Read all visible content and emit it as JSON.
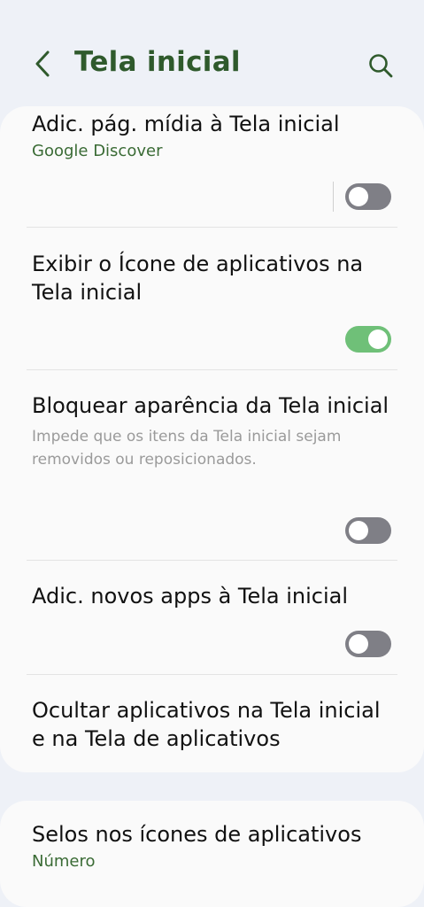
{
  "header": {
    "title": "Tela inicial",
    "back_icon": "back-arrow-icon",
    "search_icon": "search-icon"
  },
  "settings": [
    {
      "title": "Adic. pág. mídia à Tela inicial",
      "subtitle": "Google Discover",
      "toggle": "off"
    },
    {
      "title": "Exibir o Ícone de aplicativos na Tela inicial",
      "toggle": "on"
    },
    {
      "title": "Bloquear aparência da Tela inicial",
      "description": "Impede que os itens da Tela inicial sejam removidos ou reposicionados.",
      "toggle": "off"
    },
    {
      "title": "Adic. novos apps à Tela inicial",
      "toggle": "off"
    },
    {
      "title": "Ocultar aplicativos na Tela inicial e na Tela de aplicativos"
    }
  ],
  "badges": {
    "title": "Selos nos ícones de aplicativos",
    "subtitle": "Número"
  },
  "colors": {
    "accent": "#2f5a2c",
    "toggle_on": "#6fc078",
    "toggle_off": "#7f7f86",
    "background": "#eef1f7",
    "card": "#fafafa"
  }
}
